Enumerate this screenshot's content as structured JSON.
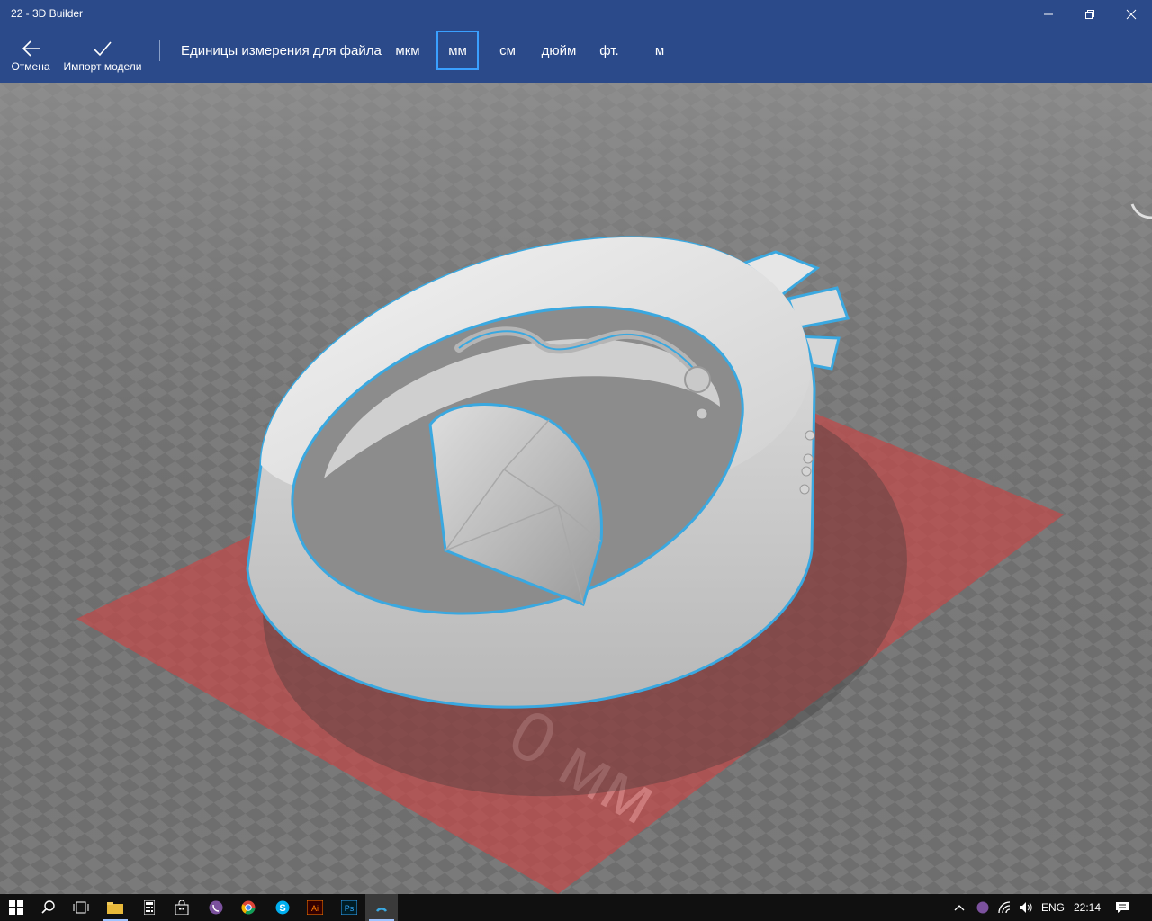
{
  "window": {
    "title": "22 - 3D Builder"
  },
  "toolbar": {
    "cancel_label": "Отмена",
    "import_label": "Импорт модели",
    "units_label": "Единицы измерения для файла",
    "units": [
      "мкм",
      "мм",
      "см",
      "дюйм",
      "фт.",
      "м"
    ],
    "selected_unit": "мм"
  },
  "viewport": {
    "plate_label": "0 мм",
    "selection_color": "#3aa8e0",
    "plate_color": "#c24a4a"
  },
  "taskbar": {
    "language": "ENG",
    "time": "22:14",
    "apps": [
      "start",
      "search",
      "task-view",
      "file-explorer",
      "calculator",
      "store",
      "viber",
      "chrome",
      "skype",
      "illustrator",
      "photoshop",
      "3d-builder"
    ]
  }
}
